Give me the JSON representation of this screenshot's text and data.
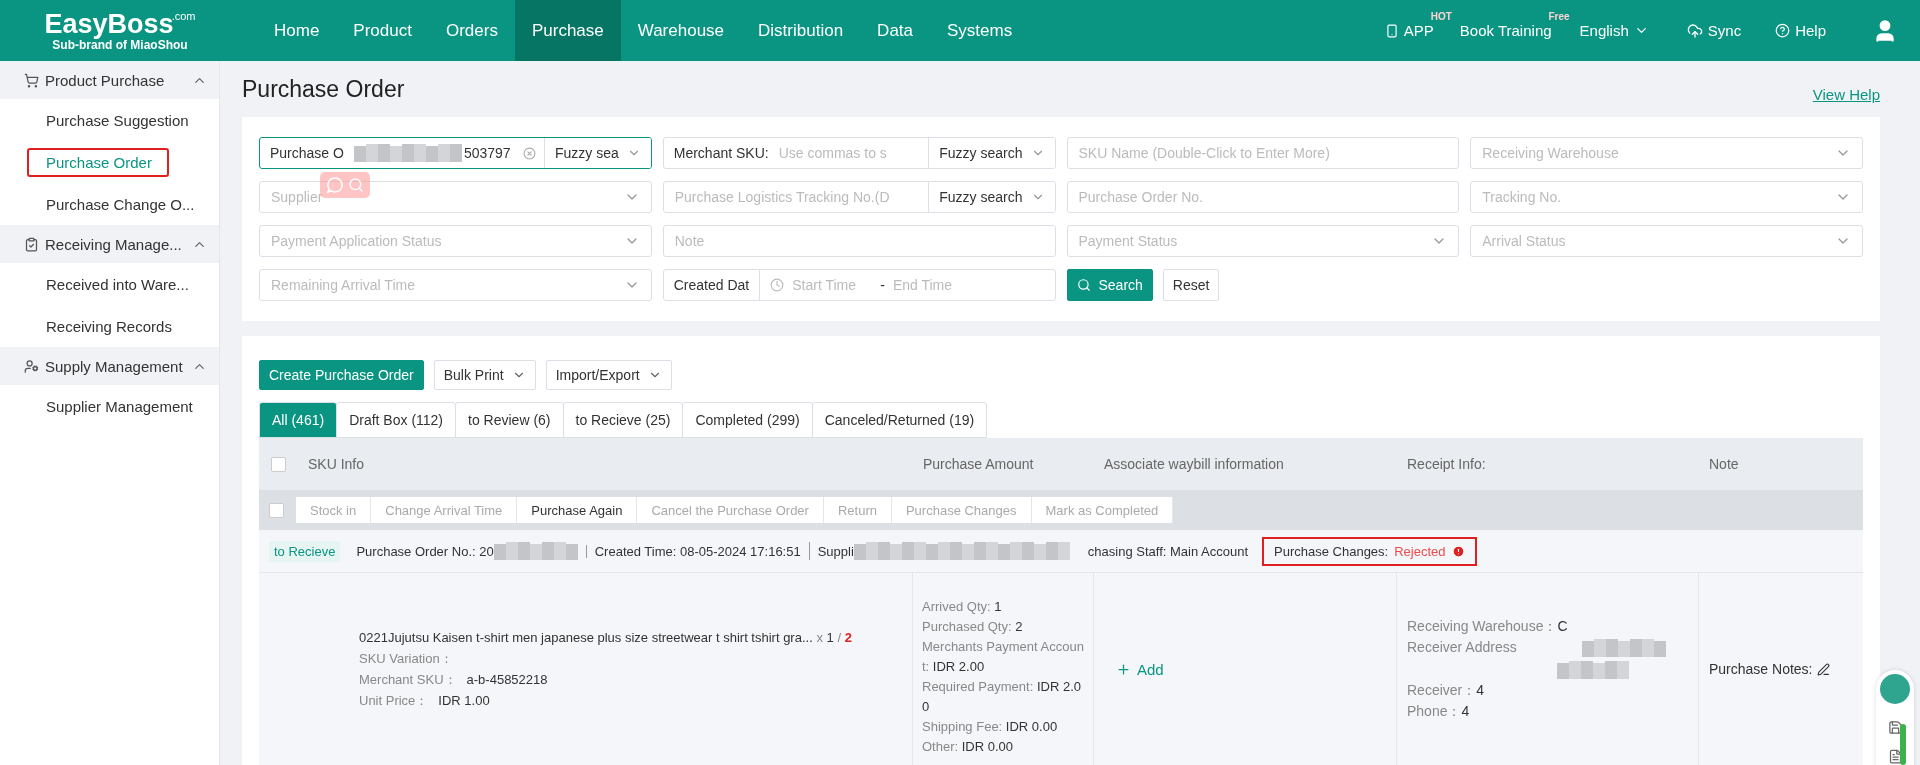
{
  "nav": {
    "logo": {
      "name": "EasyBoss",
      "suffix": ".com",
      "tagline": "Sub-brand of MiaoShou"
    },
    "items": [
      {
        "label": "Home",
        "selected": false
      },
      {
        "label": "Product",
        "selected": false
      },
      {
        "label": "Orders",
        "selected": false
      },
      {
        "label": "Purchase",
        "selected": true
      },
      {
        "label": "Warehouse",
        "selected": false
      },
      {
        "label": "Distribution",
        "selected": false
      },
      {
        "label": "Data",
        "selected": false
      },
      {
        "label": "Systems",
        "selected": false
      }
    ],
    "app": {
      "label": "APP",
      "badge": "HOT"
    },
    "training": {
      "label": "Book Training",
      "badge": "Free"
    },
    "language": "English",
    "sync": "Sync",
    "help": "Help"
  },
  "sidebar": [
    {
      "label": "Product Purchase",
      "expanded": true,
      "items": [
        {
          "label": "Purchase Suggestion",
          "selected": false,
          "highlighted": false
        },
        {
          "label": "Purchase Order",
          "selected": true,
          "highlighted": true
        },
        {
          "label": "Purchase Change O...",
          "selected": false,
          "highlighted": false
        }
      ]
    },
    {
      "label": "Receiving Manage...",
      "expanded": true,
      "items": [
        {
          "label": "Received into Ware...",
          "selected": false,
          "highlighted": false
        },
        {
          "label": "Receiving Records",
          "selected": false,
          "highlighted": false
        }
      ]
    },
    {
      "label": "Supply Management",
      "expanded": true,
      "items": [
        {
          "label": "Supplier Management",
          "selected": false,
          "highlighted": false
        }
      ]
    }
  ],
  "page": {
    "title": "Purchase Order",
    "help_link": "View Help"
  },
  "filters": [
    {
      "kind": "combo",
      "label": "Purchase O",
      "value": "503797",
      "mode": "Fuzzy sea"
    },
    {
      "kind": "prefixed",
      "label": "Merchant SKU:",
      "placeholder": "Use commas to s",
      "mode": "Fuzzy search"
    },
    {
      "kind": "input",
      "placeholder": "SKU Name (Double-Click to Enter More)"
    },
    {
      "kind": "select",
      "placeholder": "Receiving Warehouse"
    },
    {
      "kind": "select",
      "placeholder": "Supplier"
    },
    {
      "kind": "modeinput",
      "placeholder": "Purchase Logistics Tracking No.(D",
      "mode": "Fuzzy search"
    },
    {
      "kind": "input",
      "placeholder": "Purchase Order No."
    },
    {
      "kind": "select",
      "placeholder": "Tracking No."
    },
    {
      "kind": "select",
      "placeholder": "Payment Application Status"
    },
    {
      "kind": "input",
      "placeholder": "Note"
    },
    {
      "kind": "select",
      "placeholder": "Payment Status"
    },
    {
      "kind": "select",
      "placeholder": "Arrival Status"
    },
    {
      "kind": "select",
      "placeholder": "Remaining Arrival Time"
    },
    {
      "kind": "daterange",
      "label": "Created Dat",
      "start": "Start Time",
      "separator": "-",
      "end": "End Time"
    }
  ],
  "filter_buttons": [
    {
      "label": "Search",
      "kind": "primary"
    },
    {
      "label": "Reset",
      "kind": "plain"
    }
  ],
  "toolbar": [
    {
      "label": "Create Purchase Order",
      "kind": "primary"
    },
    {
      "label": "Bulk Print",
      "kind": "dropdown"
    },
    {
      "label": "Import/Export",
      "kind": "dropdown"
    }
  ],
  "tabs": [
    {
      "label": "All (461)",
      "selected": true
    },
    {
      "label": "Draft Box (112)",
      "selected": false
    },
    {
      "label": "to Review (6)",
      "selected": false
    },
    {
      "label": "to Recieve (25)",
      "selected": false
    },
    {
      "label": "Completed (299)",
      "selected": false
    },
    {
      "label": "Canceled/Returned (19)",
      "selected": false
    }
  ],
  "table": {
    "select_all": false,
    "columns": [
      "SKU Info",
      "Purchase Amount",
      "Associate waybill information",
      "Receipt Info:",
      "Note"
    ],
    "actions_checked": false,
    "actions": [
      {
        "label": "Stock in",
        "disabled": true
      },
      {
        "label": "Change Arrival Time",
        "disabled": true
      },
      {
        "label": "Purchase Again",
        "disabled": false
      },
      {
        "label": "Cancel the Purchase Order",
        "disabled": true
      },
      {
        "label": "Return",
        "disabled": true
      },
      {
        "label": "Purchase Changes",
        "disabled": true
      },
      {
        "label": "Mark as Completed",
        "disabled": true
      }
    ],
    "order": {
      "status": "to Recieve",
      "order_no": "Purchase Order No.: 20",
      "created": "Created Time: 08-05-2024 17:16:51",
      "supplier": "Suppli",
      "staff": "chasing Staff: Main Account",
      "changes_label": "Purchase Changes:",
      "changes_value": "Rejected",
      "changes_highlighted": true,
      "item": {
        "name": "0221Jujutsu Kaisen t-shirt men japanese plus size streetwear t shirt tshirt gra...",
        "qty_prefix": "x",
        "qty_arrived": "1",
        "qty_sep": "/",
        "qty_total": "2",
        "details": [
          {
            "label": "SKU Variation："
          },
          {
            "label": "Merchant SKU：",
            "value": "a-b-45852218"
          },
          {
            "label": "Unit Price：",
            "value": "IDR 1.00"
          }
        ]
      },
      "amounts": [
        {
          "label": "Arrived Qty:",
          "value": "1"
        },
        {
          "label": "Purchased Qty:",
          "value": "2"
        },
        {
          "label": "Merchants Payment Account:",
          "value": "IDR 2.00"
        },
        {
          "label": "Required Payment:",
          "value": "IDR 2.00"
        },
        {
          "label": "Shipping Fee:",
          "value": "IDR 0.00"
        },
        {
          "label": "Other:",
          "value": "IDR 0.00"
        }
      ],
      "waybill_add": "Add",
      "receipt": [
        {
          "label": "Receiving Warehouse：",
          "value": "C"
        },
        {
          "label": "Receiver Address"
        },
        {
          "label": "Receiver：",
          "value": "4"
        },
        {
          "label": "Phone：",
          "value": "4"
        }
      ],
      "note_label": "Purchase Notes:"
    }
  }
}
